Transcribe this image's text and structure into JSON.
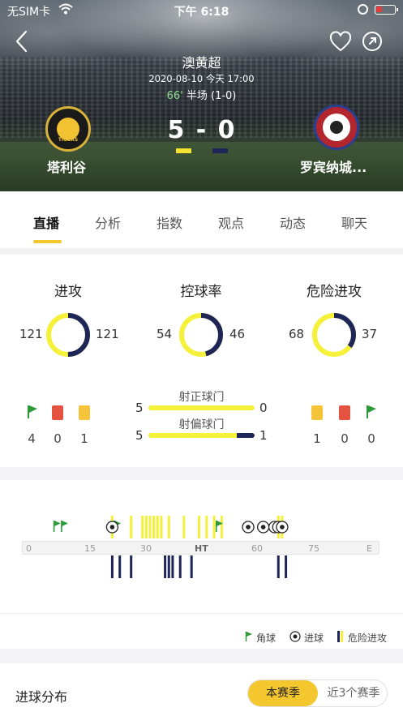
{
  "status_bar": {
    "carrier": "无SIM卡",
    "time": "下午 6:18"
  },
  "match": {
    "league": "澳黄超",
    "datetime": "2020-08-10 今天 17:00",
    "minute": "66'",
    "status": "半场 (1-0)",
    "score": "5 - 0",
    "home": {
      "name": "塔利谷",
      "logo_text": "TIGERS"
    },
    "away": {
      "name": "罗宾纳城..."
    }
  },
  "tabs": [
    {
      "label": "直播",
      "active": true
    },
    {
      "label": "分析"
    },
    {
      "label": "指数"
    },
    {
      "label": "观点"
    },
    {
      "label": "动态"
    },
    {
      "label": "聊天"
    }
  ],
  "stats": {
    "attack": {
      "label": "进攻",
      "home": "121",
      "away": "121"
    },
    "possession": {
      "label": "控球率",
      "home": "54",
      "away": "46"
    },
    "danger": {
      "label": "危险进攻",
      "home": "68",
      "away": "37"
    },
    "home_counts": {
      "corners": "4",
      "red": "0",
      "yellow": "1"
    },
    "away_counts": {
      "yellow": "1",
      "red": "0",
      "corners": "0"
    },
    "shots_on": {
      "label": "射正球门",
      "home": "5",
      "away": "0"
    },
    "shots_off": {
      "label": "射偏球门",
      "home": "5",
      "away": "1"
    }
  },
  "timeline": {
    "ticks": [
      "0",
      "15",
      "30",
      "HT",
      "60",
      "75",
      "E"
    ],
    "corners": [
      7,
      9,
      23,
      50
    ],
    "goals": [
      22,
      58,
      62,
      65,
      66,
      67
    ],
    "home_danger": [
      22,
      27,
      30,
      31,
      32,
      33,
      34,
      35,
      37,
      41,
      45,
      47,
      49,
      51,
      66,
      67
    ],
    "away_danger": [
      22,
      24,
      27,
      36,
      37,
      38,
      40,
      43,
      66,
      68
    ],
    "legend": {
      "corner": "角球",
      "goal": "进球",
      "danger": "危险进攻"
    },
    "colors": {
      "home": "#f5f03a",
      "away": "#1e2557",
      "corner": "#2e9a3a"
    }
  },
  "distribution": {
    "title": "进球分布",
    "options": [
      "本赛季",
      "近3个赛季"
    ]
  }
}
